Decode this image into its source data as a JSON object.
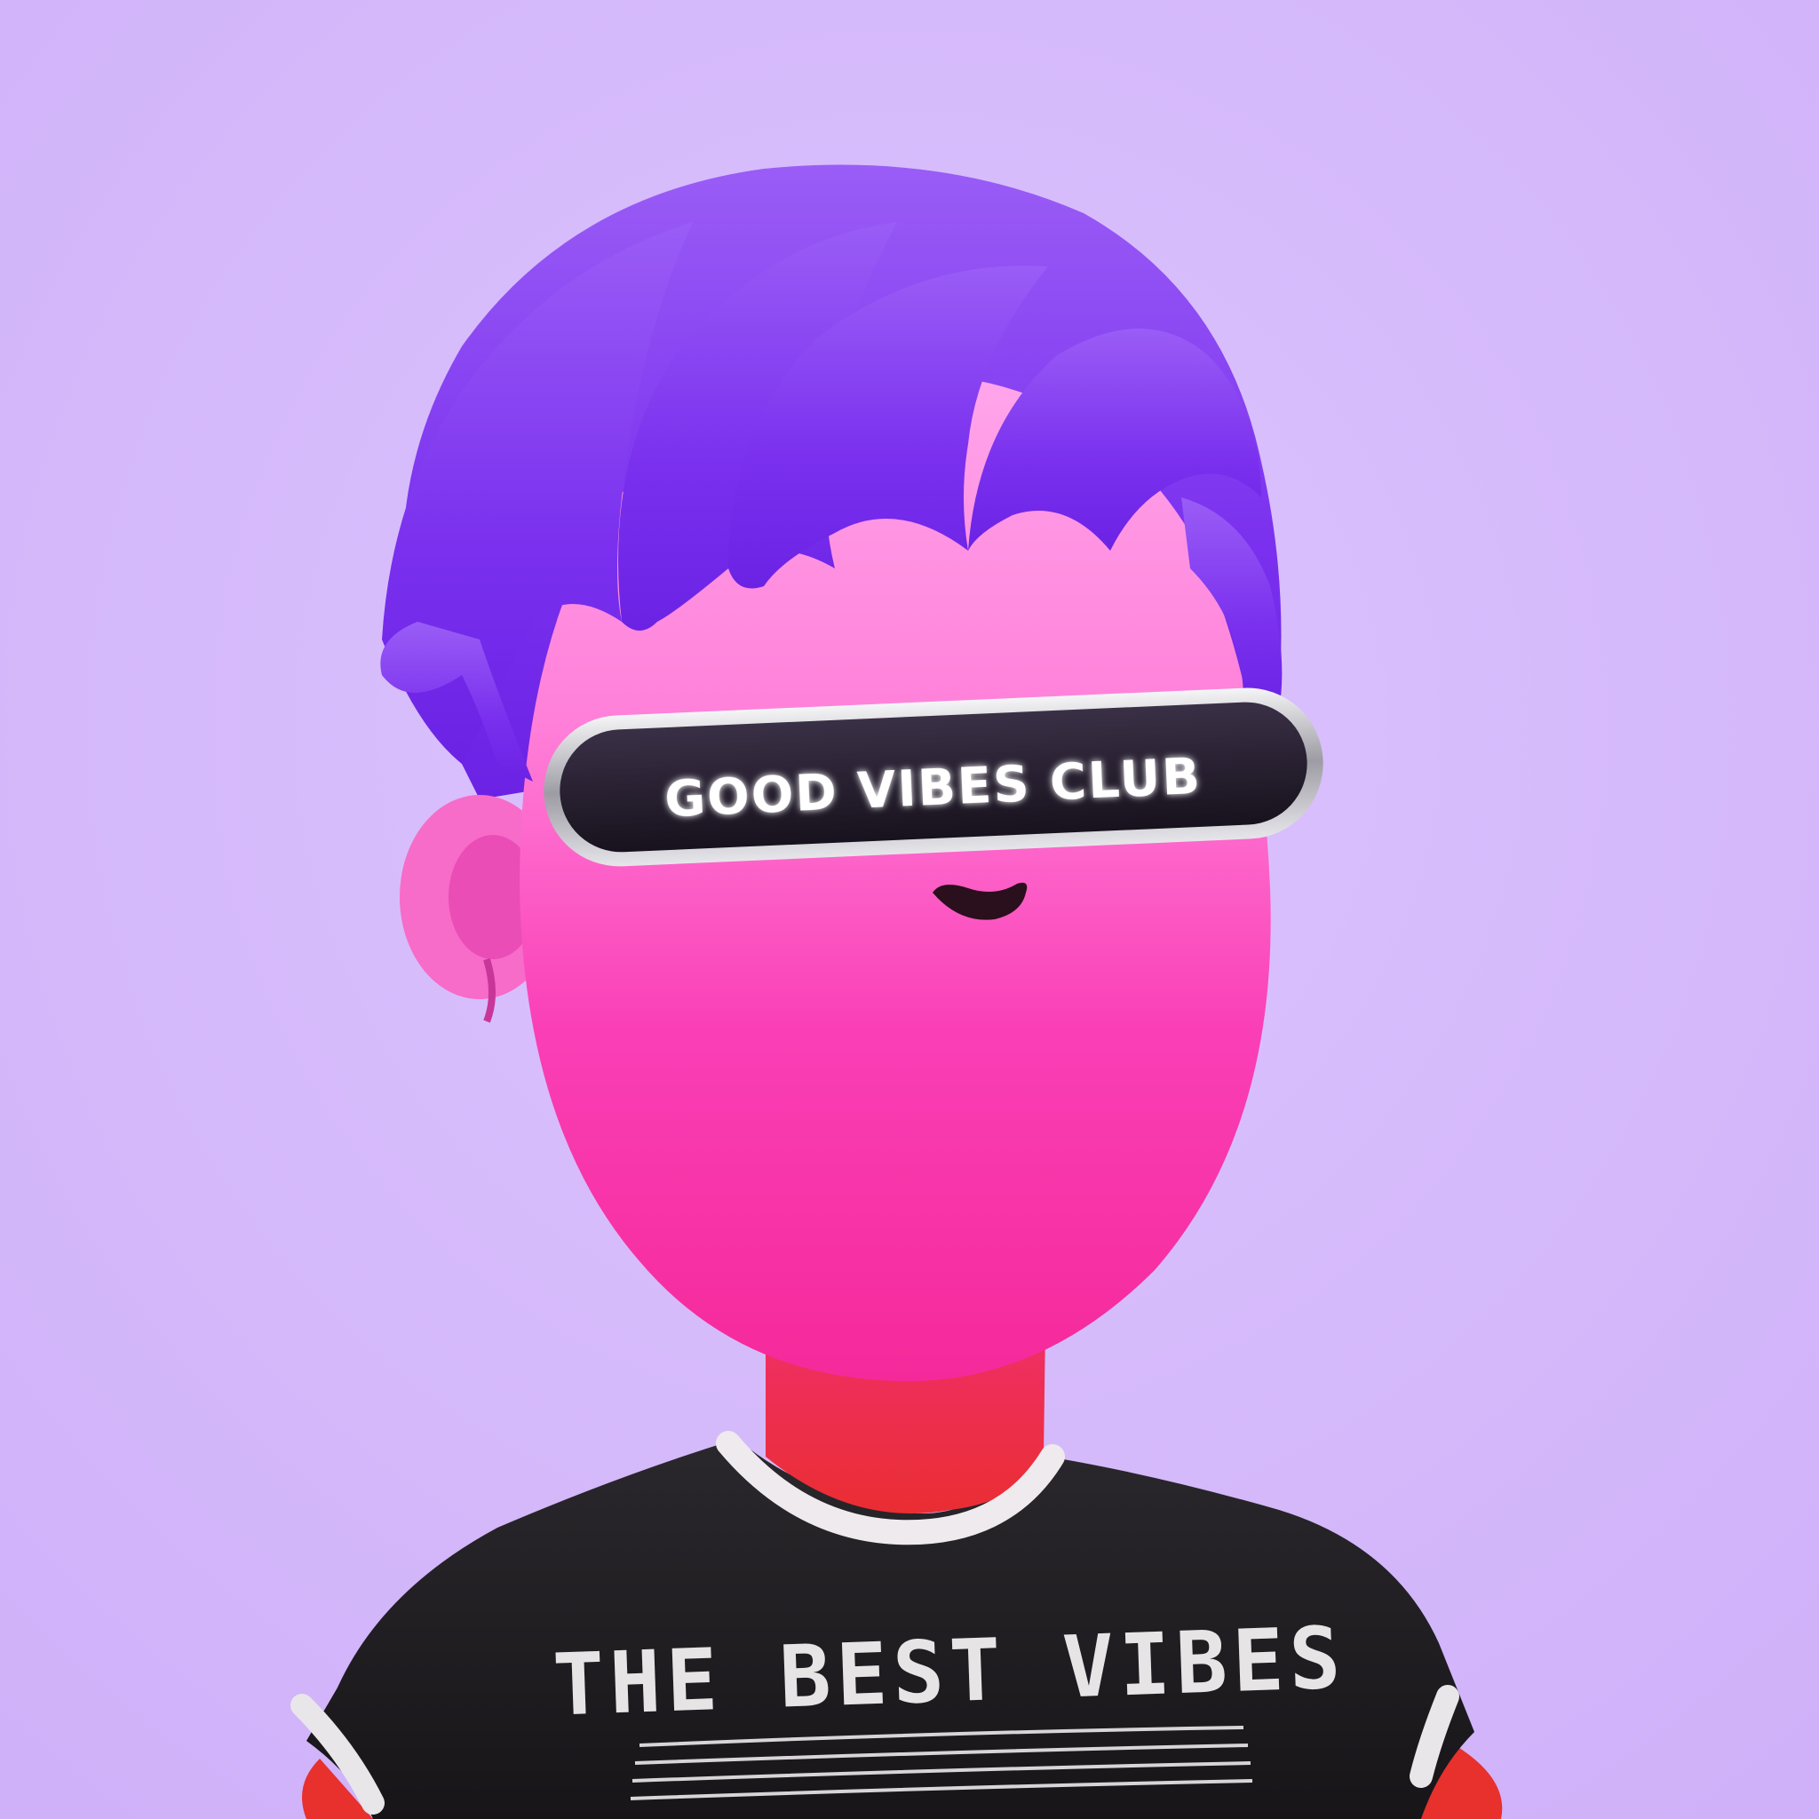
{
  "visor": {
    "text": "GOOD VIBES CLUB"
  },
  "shirt": {
    "text": "THE BEST VIBES"
  },
  "colors": {
    "background": "#d6b9fb",
    "skin": "#f23fb0",
    "hair": "#7b2ff0",
    "shirt": "#1e1c1f",
    "neck": "#f0304f",
    "visor_frame": "#c8c8cc",
    "visor_glass": "#241c2c"
  }
}
